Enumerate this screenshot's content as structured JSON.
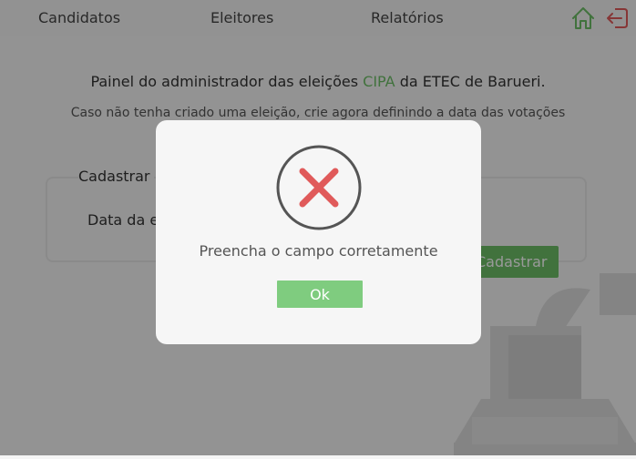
{
  "nav": {
    "items": [
      {
        "label": "Candidatos"
      },
      {
        "label": "Eleitores"
      },
      {
        "label": "Relatórios"
      }
    ],
    "home_icon": "home-icon",
    "logout_icon": "logout-icon"
  },
  "intro": {
    "before": "Painel do administrador das eleições ",
    "accent": "CIPA",
    "after": " da ETEC de Barueri.",
    "subtitle": "Caso não tenha criado uma eleição, crie agora definindo a data das votações"
  },
  "form": {
    "title": "Cadastrar",
    "date_label": "Data da e",
    "submit_label": "Cadastrar"
  },
  "modal": {
    "icon": "error-x-icon",
    "message": "Preencha o campo corretamente",
    "ok_label": "Ok"
  },
  "colors": {
    "accent": "#6dbf67",
    "error": "#e05a5a",
    "logout": "#e05a5a"
  }
}
